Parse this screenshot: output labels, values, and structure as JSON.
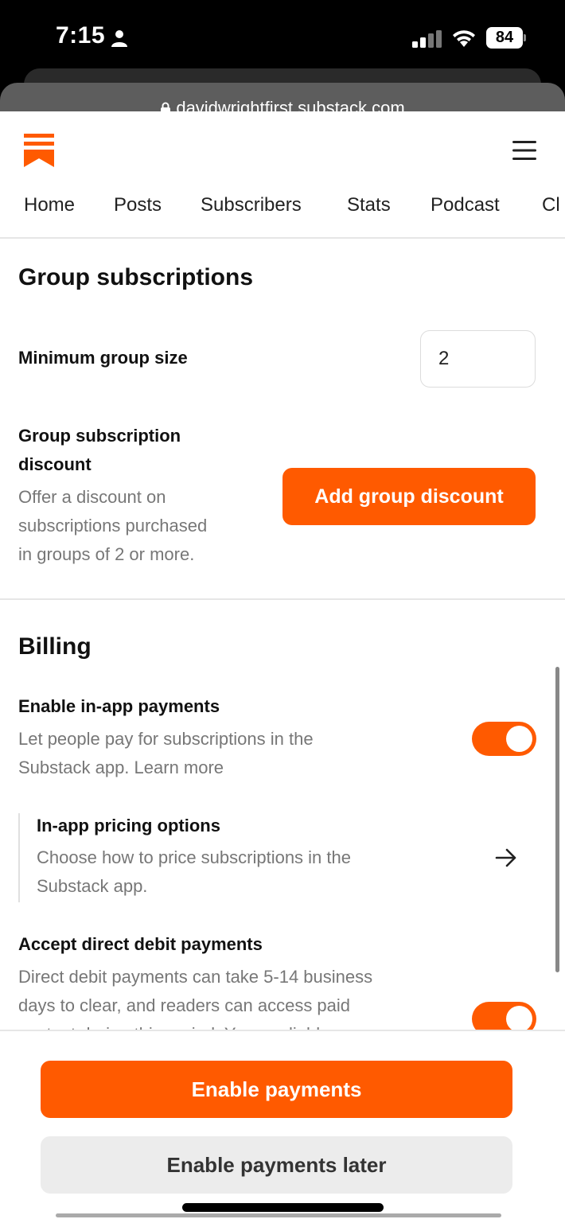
{
  "status_bar": {
    "time": "7:15",
    "battery": "84"
  },
  "browser": {
    "url": "davidwrightfirst.substack.com"
  },
  "nav": {
    "items": [
      "Home",
      "Posts",
      "Subscribers",
      "Stats",
      "Podcast",
      "Cl"
    ]
  },
  "group_subscriptions": {
    "title": "Group subscriptions",
    "min_size_label": "Minimum group size",
    "min_size_value": "2",
    "discount_label_line1": "Group subscription",
    "discount_label_line2": "discount",
    "discount_desc_line1": "Offer a discount on",
    "discount_desc_line2": "subscriptions purchased",
    "discount_desc_line3": "in groups of 2 or more.",
    "add_discount_button": "Add group discount"
  },
  "billing": {
    "title": "Billing",
    "in_app_label": "Enable in-app payments",
    "in_app_desc_line1": "Let people pay for subscriptions in the",
    "in_app_desc_line2": "Substack app. Learn more",
    "in_app_enabled": true,
    "pricing_label": "In-app pricing options",
    "pricing_desc_line1": "Choose how to price subscriptions in the",
    "pricing_desc_line2": "Substack app.",
    "direct_debit_label": "Accept direct debit payments",
    "direct_debit_desc_line1": "Direct debit payments can take 5-14 business",
    "direct_debit_desc_line2": "days to clear, and readers can access paid",
    "direct_debit_desc_line3": "content during this period. You are liable",
    "direct_debit_enabled": true
  },
  "footer": {
    "enable_button": "Enable payments",
    "later_button": "Enable payments later"
  },
  "colors": {
    "accent": "#ff5a00",
    "muted_text": "#777777"
  }
}
